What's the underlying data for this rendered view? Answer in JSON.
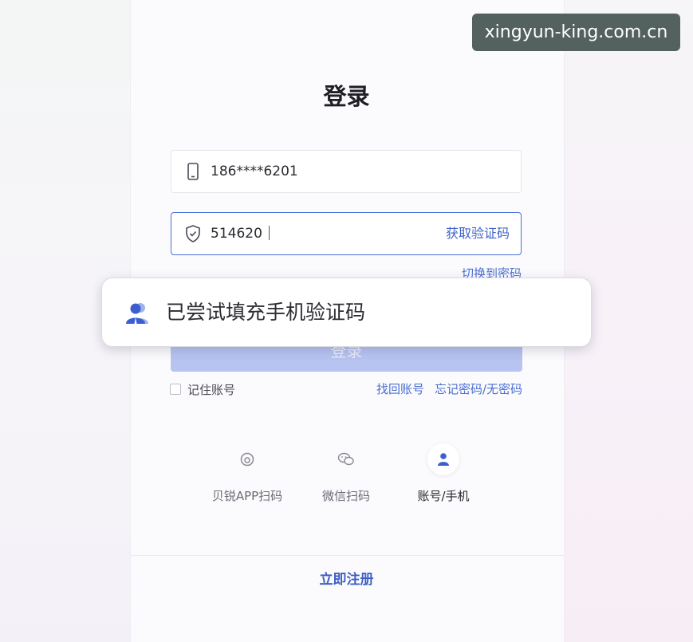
{
  "watermark": "xingyun-king.com.cn",
  "title": "登录",
  "phone_field": {
    "value": "186****6201",
    "icon": "phone-icon"
  },
  "code_field": {
    "value": "514620",
    "icon": "shield-icon",
    "get_code": "获取验证码"
  },
  "switch_to_password": "切换到密码",
  "login_button": "登录",
  "toast": {
    "message": "已尝试填充手机验证码",
    "icon": "user-avatar-icon"
  },
  "remember": {
    "label": "记住账号",
    "checked": false
  },
  "find_account": "找回账号",
  "forgot_password": "忘记密码/无密码",
  "methods": [
    {
      "label": "贝锐APP扫码",
      "icon": "app-scan-icon",
      "active": false
    },
    {
      "label": "微信扫码",
      "icon": "wechat-icon",
      "active": false
    },
    {
      "label": "账号/手机",
      "icon": "user-icon",
      "active": true
    }
  ],
  "register": "立即注册",
  "colors": {
    "accent": "#4a6fd8",
    "link": "#4b6fcf",
    "button_disabled": "#b7c3f0"
  }
}
